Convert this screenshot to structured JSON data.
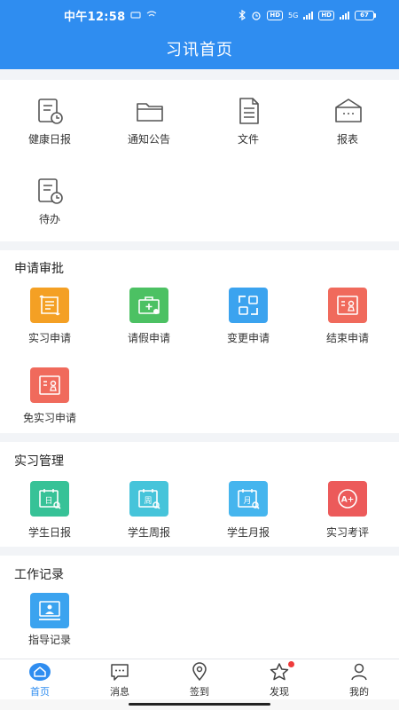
{
  "status": {
    "time": "中午12:58",
    "network": "5G",
    "battery": "67"
  },
  "title": "习讯首页",
  "quick": {
    "items": [
      {
        "label": "健康日报"
      },
      {
        "label": "通知公告"
      },
      {
        "label": "文件"
      },
      {
        "label": "报表"
      },
      {
        "label": "待办"
      }
    ]
  },
  "apply": {
    "title": "申请审批",
    "items": [
      {
        "label": "实习申请"
      },
      {
        "label": "请假申请"
      },
      {
        "label": "变更申请"
      },
      {
        "label": "结束申请"
      },
      {
        "label": "免实习申请"
      }
    ]
  },
  "manage": {
    "title": "实习管理",
    "items": [
      {
        "label": "学生日报",
        "glyph": "日"
      },
      {
        "label": "学生周报",
        "glyph": "周"
      },
      {
        "label": "学生月报",
        "glyph": "月"
      },
      {
        "label": "实习考评",
        "glyph": "A+"
      }
    ]
  },
  "records": {
    "title": "工作记录",
    "items": [
      {
        "label": "指导记录"
      }
    ]
  },
  "tabs": [
    {
      "label": "首页"
    },
    {
      "label": "消息"
    },
    {
      "label": "签到"
    },
    {
      "label": "发现"
    },
    {
      "label": "我的"
    }
  ],
  "colors": {
    "primary": "#2f8df0",
    "orange": "#f4a024",
    "green": "#4cc163",
    "blue": "#3ba3ef",
    "red": "#f06a5c",
    "teal": "#37c297",
    "cyan": "#46c4da",
    "skyblue": "#45b5ee",
    "crimson": "#ec5a5a"
  }
}
